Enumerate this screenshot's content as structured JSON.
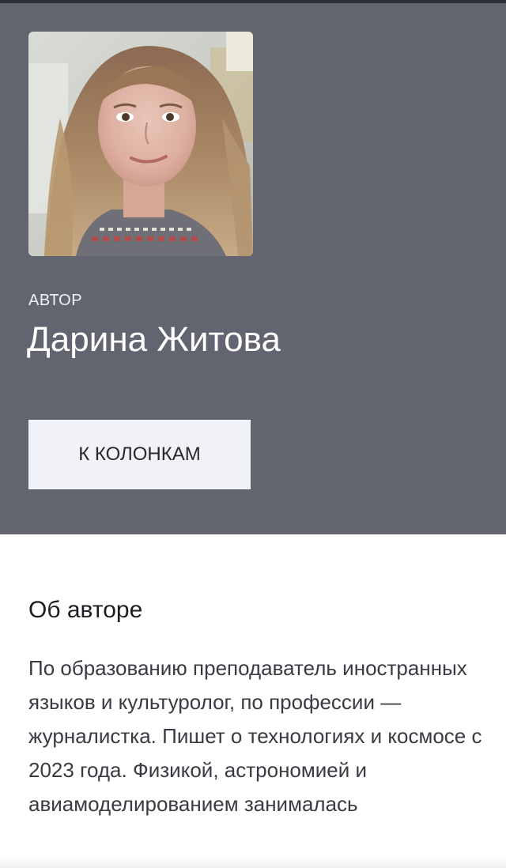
{
  "author": {
    "role_label": "АВТОР",
    "name": "Дарина Житова",
    "photo_alt": "Дарина Житова"
  },
  "actions": {
    "columns_button_label": "К КОЛОНКАМ"
  },
  "about": {
    "title": "Об авторе",
    "text": "По образованию преподаватель иностранных языков и культуролог, по профессии — журналистка. Пишет о технологиях и космосе с 2023 года. Физикой, астрономией и авиамоделированием занималась"
  },
  "colors": {
    "hero_background": "#62646f",
    "button_background": "#f1f2f7",
    "text_dark": "#1c1d22"
  }
}
